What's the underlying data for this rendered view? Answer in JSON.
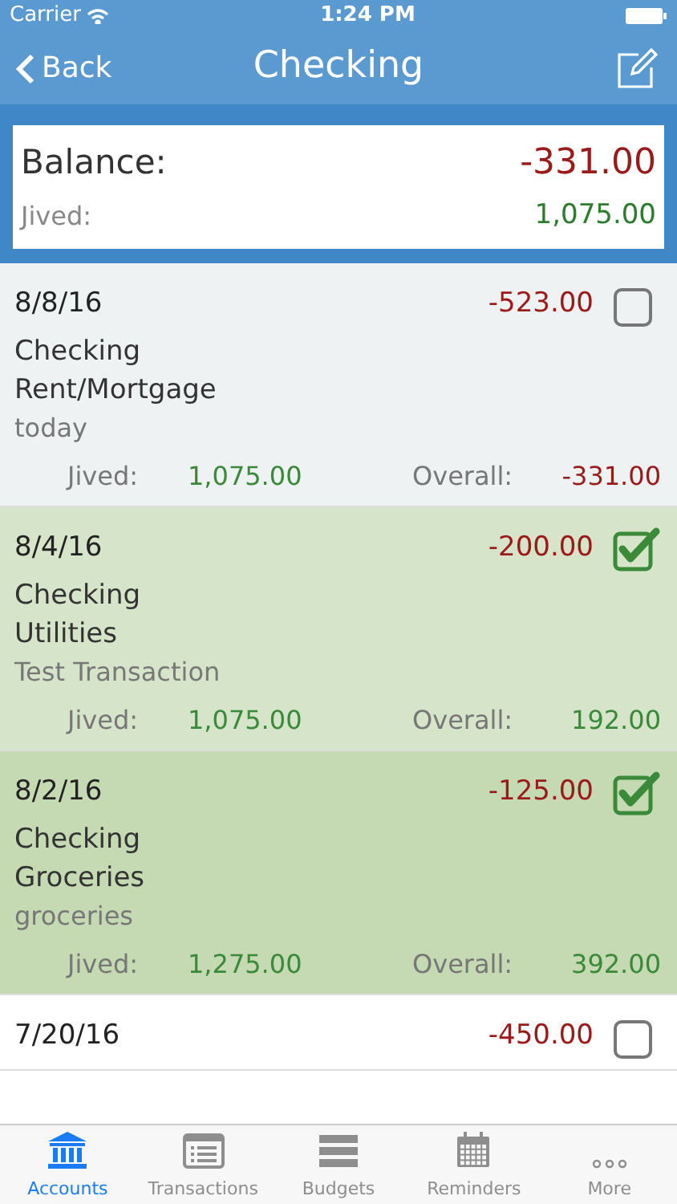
{
  "status_bar": {
    "carrier": "Carrier",
    "time": "1:24 PM"
  },
  "nav": {
    "back": "Back",
    "title": "Checking"
  },
  "balance": {
    "label": "Balance:",
    "amount": "-331.00",
    "jived_label": "Jived:",
    "jived": "1,075.00"
  },
  "transactions": [
    {
      "date": "8/8/16",
      "amount": "-523.00",
      "checked": false,
      "color": "#eef2f3",
      "account": "Checking",
      "category": "Rent/Mortgage",
      "memo": "today",
      "jived_label": "Jived:",
      "jived": "1,075.00",
      "overall_label": "Overall:",
      "overall": "-331.00",
      "overall_negative": true
    },
    {
      "date": "8/4/16",
      "amount": "-200.00",
      "checked": true,
      "color": "#d6e5c9",
      "account": "Checking",
      "category": "Utilities",
      "memo": "Test Transaction",
      "jived_label": "Jived:",
      "jived": "1,075.00",
      "overall_label": "Overall:",
      "overall": "192.00",
      "overall_negative": false
    },
    {
      "date": "8/2/16",
      "amount": "-125.00",
      "checked": true,
      "color": "#c5d9b3",
      "account": "Checking",
      "category": "Groceries",
      "memo": "groceries",
      "jived_label": "Jived:",
      "jived": "1,275.00",
      "overall_label": "Overall:",
      "overall": "392.00",
      "overall_negative": false
    },
    {
      "date": "7/20/16",
      "amount": "-450.00",
      "checked": false,
      "color": "#ffffff"
    }
  ],
  "tabs": [
    {
      "kind": "bank",
      "label": "Accounts",
      "selected": true
    },
    {
      "kind": "list",
      "label": "Transactions",
      "selected": false
    },
    {
      "kind": "stack",
      "label": "Budgets",
      "selected": false
    },
    {
      "kind": "calendar",
      "label": "Reminders",
      "selected": false
    },
    {
      "kind": "more",
      "label": "More",
      "selected": false
    }
  ]
}
